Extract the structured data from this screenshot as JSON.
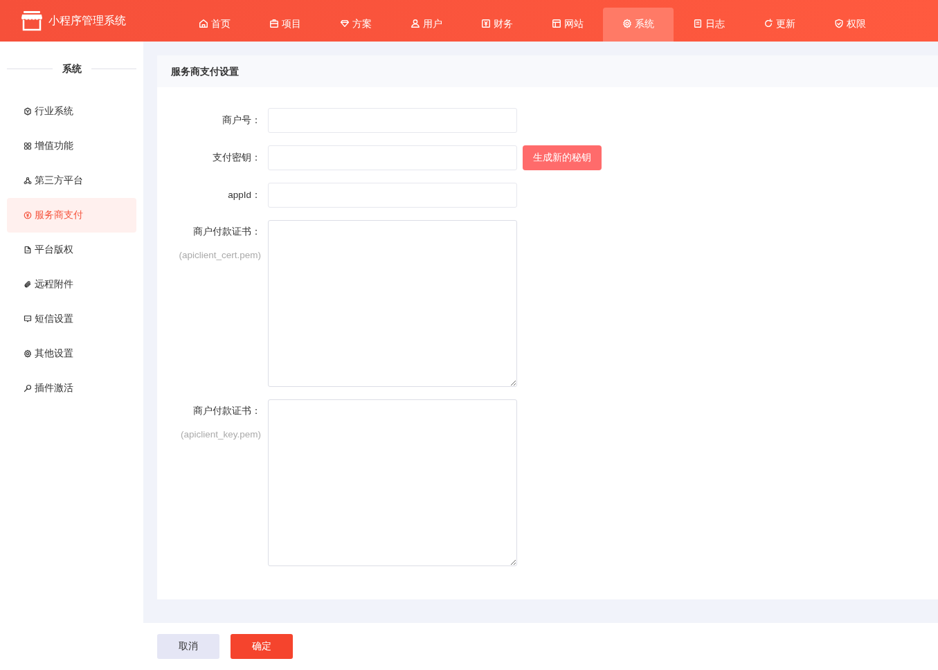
{
  "app": {
    "title": "小程序管理系统"
  },
  "nav": [
    {
      "label": "首页",
      "selected": false
    },
    {
      "label": "项目",
      "selected": false
    },
    {
      "label": "方案",
      "selected": false
    },
    {
      "label": "用户",
      "selected": false
    },
    {
      "label": "财务",
      "selected": false
    },
    {
      "label": "网站",
      "selected": false
    },
    {
      "label": "系统",
      "selected": true
    },
    {
      "label": "日志",
      "selected": false
    },
    {
      "label": "更新",
      "selected": false
    },
    {
      "label": "权限",
      "selected": false
    }
  ],
  "sidebar": {
    "title": "系统",
    "items": [
      {
        "label": "行业系统",
        "selected": false
      },
      {
        "label": "增值功能",
        "selected": false
      },
      {
        "label": "第三方平台",
        "selected": false
      },
      {
        "label": "服务商支付",
        "selected": true
      },
      {
        "label": "平台版权",
        "selected": false
      },
      {
        "label": "远程附件",
        "selected": false
      },
      {
        "label": "短信设置",
        "selected": false
      },
      {
        "label": "其他设置",
        "selected": false
      },
      {
        "label": "插件激活",
        "selected": false
      }
    ]
  },
  "panel": {
    "title": "服务商支付设置",
    "fields": [
      {
        "kind": "input",
        "label": "商户号："
      },
      {
        "kind": "input",
        "label": "支付密钥：",
        "button": "生成新的秘钥"
      },
      {
        "kind": "input",
        "label": "appId："
      },
      {
        "kind": "textarea",
        "label": "商户付款证书：",
        "hint": "(apiclient_cert.pem)"
      },
      {
        "kind": "textarea",
        "label": "商户付款证书：",
        "hint": "(apiclient_key.pem)"
      }
    ]
  },
  "footer": {
    "cancel": "取消",
    "confirm": "确定"
  }
}
